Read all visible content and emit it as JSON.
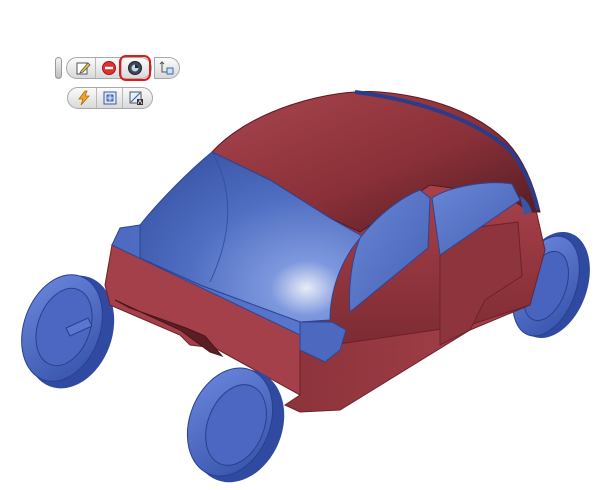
{
  "viewport": {
    "model": "car-body-3d",
    "colors": {
      "body": "#9b3a42",
      "glass": "#4f6fc0",
      "wheels": "#4a67c4",
      "background": "#ffffff"
    }
  },
  "toolbar": {
    "row1": [
      {
        "icon": "edit-sketch-icon"
      },
      {
        "icon": "stop-icon"
      },
      {
        "icon": "display-style-icon",
        "selected": true
      },
      {
        "icon": "view-orientation-icon"
      }
    ],
    "row2": [
      {
        "icon": "lightning-icon"
      },
      {
        "icon": "grid-box-icon"
      },
      {
        "icon": "section-view-icon"
      }
    ],
    "highlight_color": "#e01818"
  }
}
